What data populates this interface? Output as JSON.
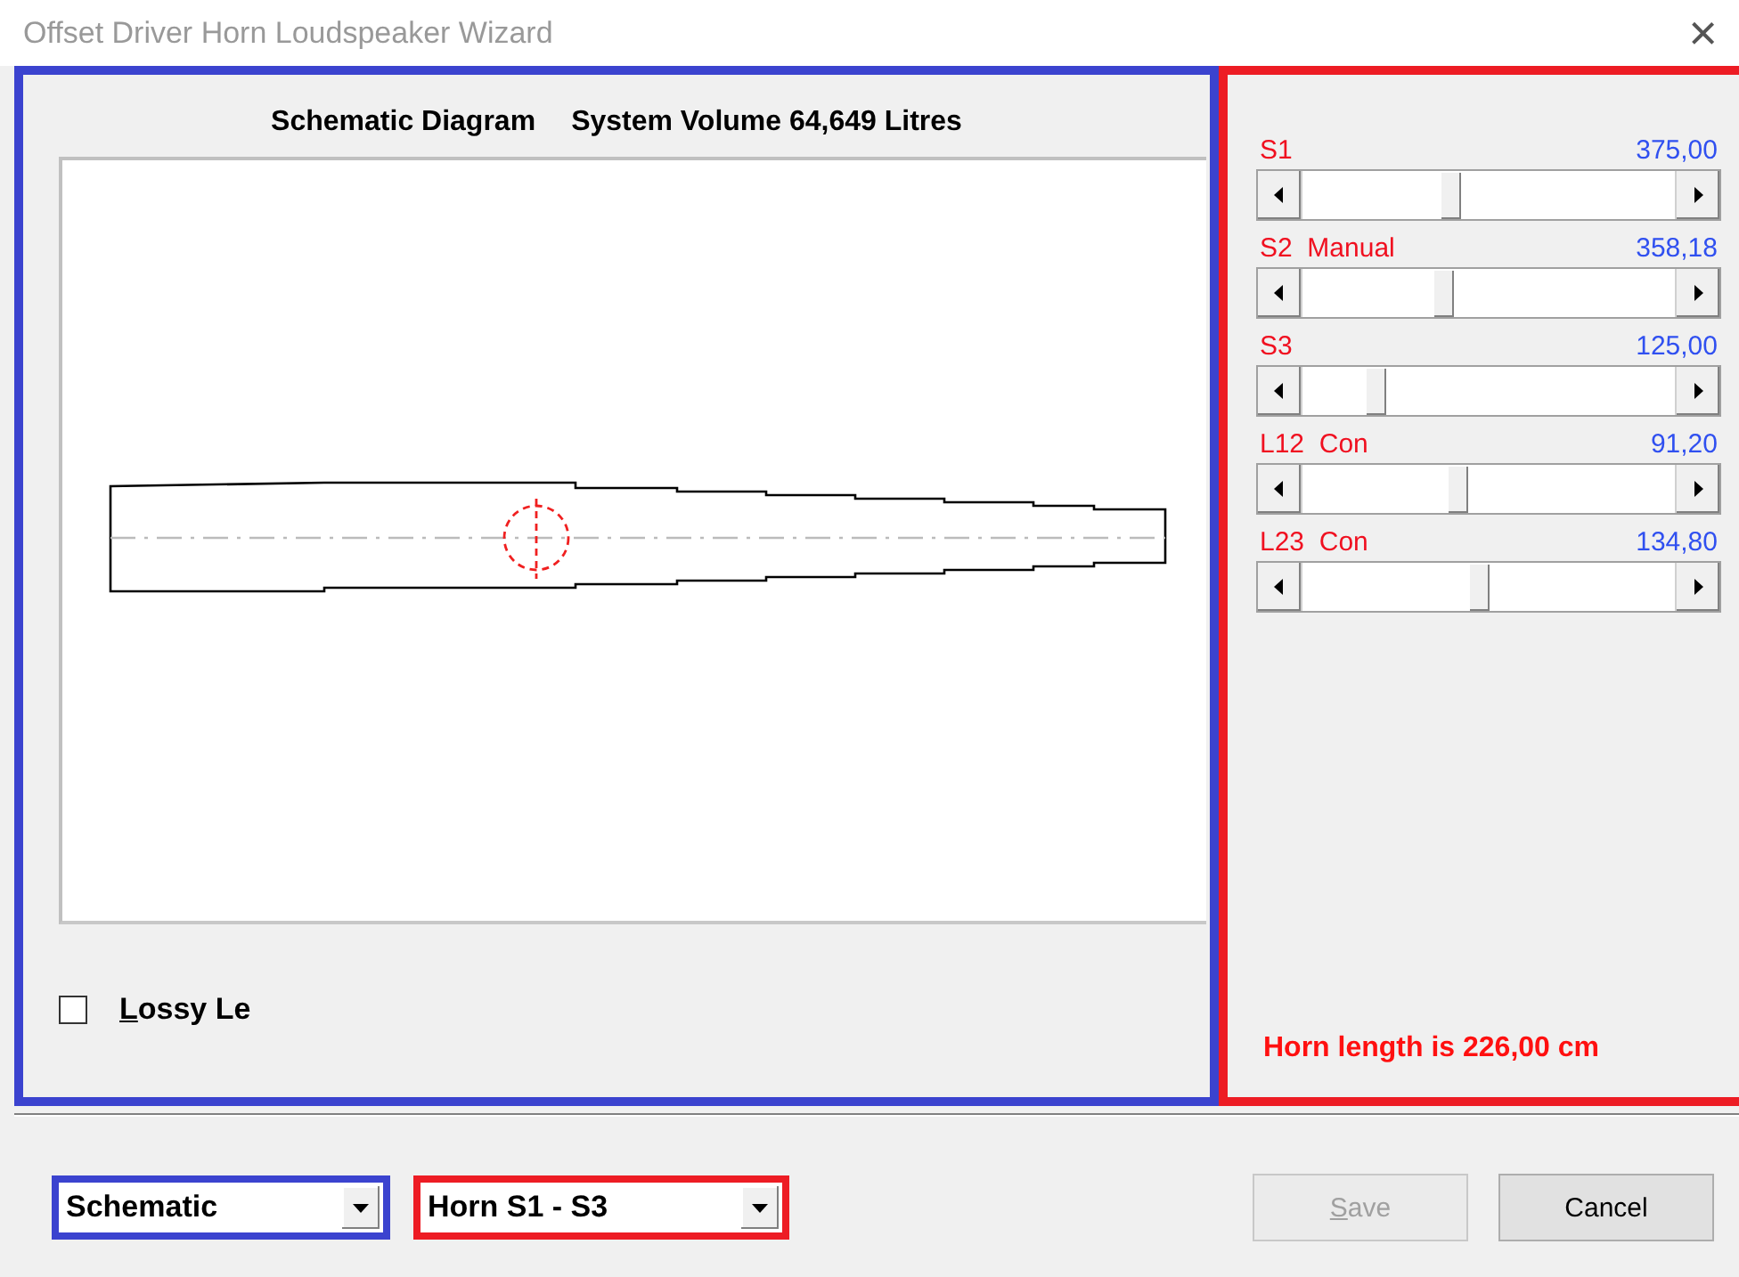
{
  "window": {
    "title": "Offset Driver Horn Loudspeaker Wizard",
    "close": "×"
  },
  "schematic": {
    "title": "Schematic Diagram",
    "volume": "System Volume 64,649 Litres"
  },
  "lossy": {
    "label": "Lossy Le",
    "checked": false
  },
  "sliders": [
    {
      "name": "S1",
      "value": "375,00",
      "level": 0.39
    },
    {
      "name": "S2  Manual",
      "value": "358,18",
      "level": 0.37
    },
    {
      "name": "S3",
      "value": "125,00",
      "level": 0.18
    },
    {
      "name": "L12  Con",
      "value": "91,20",
      "level": 0.41
    },
    {
      "name": "L23  Con",
      "value": "134,80",
      "level": 0.47
    }
  ],
  "horn_length": "Horn length is 226,00 cm",
  "view_select": {
    "value": "Schematic"
  },
  "horn_select": {
    "value": "Horn S1 - S3"
  },
  "buttons": [
    {
      "label": "Save",
      "disabled": true
    },
    {
      "label": "Cancel",
      "disabled": false
    }
  ]
}
